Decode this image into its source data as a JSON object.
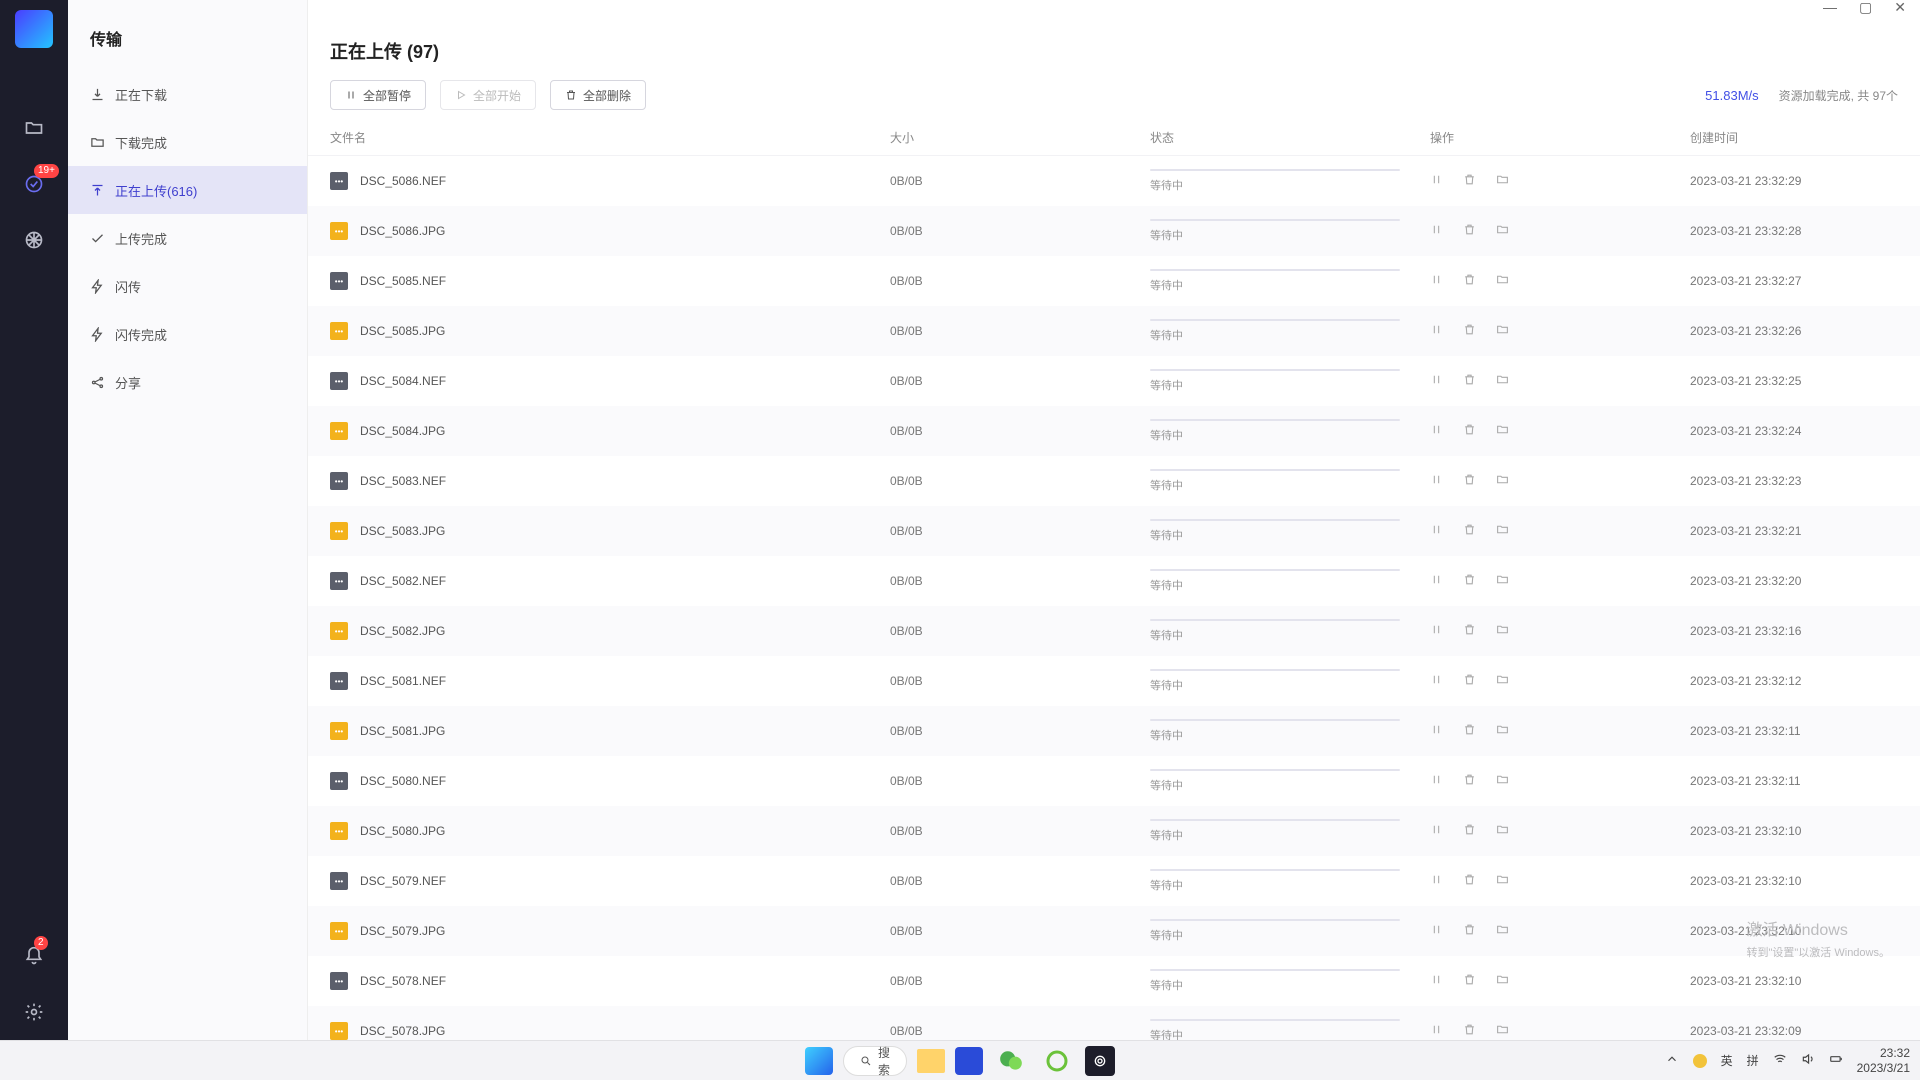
{
  "sidebar": {
    "title": "传输",
    "items": [
      {
        "label": "正在下载",
        "icon": "download"
      },
      {
        "label": "下载完成",
        "icon": "folder-check"
      },
      {
        "label": "正在上传(616)",
        "icon": "upload",
        "active": true
      },
      {
        "label": "上传完成",
        "icon": "check"
      },
      {
        "label": "闪传",
        "icon": "bolt"
      },
      {
        "label": "闪传完成",
        "icon": "bolt-check"
      },
      {
        "label": "分享",
        "icon": "share"
      }
    ]
  },
  "rail_badge": "19+",
  "notif_badge": "2",
  "page": {
    "title": "正在上传 (97)"
  },
  "toolbar": {
    "pause_all": "全部暂停",
    "start_all": "全部开始",
    "delete_all": "全部删除",
    "speed": "51.83M/s",
    "load_info": "资源加载完成, 共 97个"
  },
  "columns": {
    "name": "文件名",
    "size": "大小",
    "status": "状态",
    "ops": "操作",
    "time": "创建时间"
  },
  "status_waiting": "等待中",
  "files": [
    {
      "name": "DSC_5086.NEF",
      "type": "nef",
      "size": "0B/0B",
      "time": "2023-03-21 23:32:29"
    },
    {
      "name": "DSC_5086.JPG",
      "type": "jpg",
      "size": "0B/0B",
      "time": "2023-03-21 23:32:28"
    },
    {
      "name": "DSC_5085.NEF",
      "type": "nef",
      "size": "0B/0B",
      "time": "2023-03-21 23:32:27"
    },
    {
      "name": "DSC_5085.JPG",
      "type": "jpg",
      "size": "0B/0B",
      "time": "2023-03-21 23:32:26"
    },
    {
      "name": "DSC_5084.NEF",
      "type": "nef",
      "size": "0B/0B",
      "time": "2023-03-21 23:32:25"
    },
    {
      "name": "DSC_5084.JPG",
      "type": "jpg",
      "size": "0B/0B",
      "time": "2023-03-21 23:32:24"
    },
    {
      "name": "DSC_5083.NEF",
      "type": "nef",
      "size": "0B/0B",
      "time": "2023-03-21 23:32:23"
    },
    {
      "name": "DSC_5083.JPG",
      "type": "jpg",
      "size": "0B/0B",
      "time": "2023-03-21 23:32:21"
    },
    {
      "name": "DSC_5082.NEF",
      "type": "nef",
      "size": "0B/0B",
      "time": "2023-03-21 23:32:20"
    },
    {
      "name": "DSC_5082.JPG",
      "type": "jpg",
      "size": "0B/0B",
      "time": "2023-03-21 23:32:16"
    },
    {
      "name": "DSC_5081.NEF",
      "type": "nef",
      "size": "0B/0B",
      "time": "2023-03-21 23:32:12"
    },
    {
      "name": "DSC_5081.JPG",
      "type": "jpg",
      "size": "0B/0B",
      "time": "2023-03-21 23:32:11"
    },
    {
      "name": "DSC_5080.NEF",
      "type": "nef",
      "size": "0B/0B",
      "time": "2023-03-21 23:32:11"
    },
    {
      "name": "DSC_5080.JPG",
      "type": "jpg",
      "size": "0B/0B",
      "time": "2023-03-21 23:32:10"
    },
    {
      "name": "DSC_5079.NEF",
      "type": "nef",
      "size": "0B/0B",
      "time": "2023-03-21 23:32:10"
    },
    {
      "name": "DSC_5079.JPG",
      "type": "jpg",
      "size": "0B/0B",
      "time": "2023-03-21 23:32:10"
    },
    {
      "name": "DSC_5078.NEF",
      "type": "nef",
      "size": "0B/0B",
      "time": "2023-03-21 23:32:10"
    },
    {
      "name": "DSC_5078.JPG",
      "type": "jpg",
      "size": "0B/0B",
      "time": "2023-03-21 23:32:09"
    }
  ],
  "watermark": {
    "line1": "激活 Windows",
    "line2": "转到\"设置\"以激活 Windows。"
  },
  "taskbar": {
    "search": "搜索",
    "ime1": "英",
    "ime2": "拼",
    "time": "23:32",
    "date": "2023/3/21"
  }
}
